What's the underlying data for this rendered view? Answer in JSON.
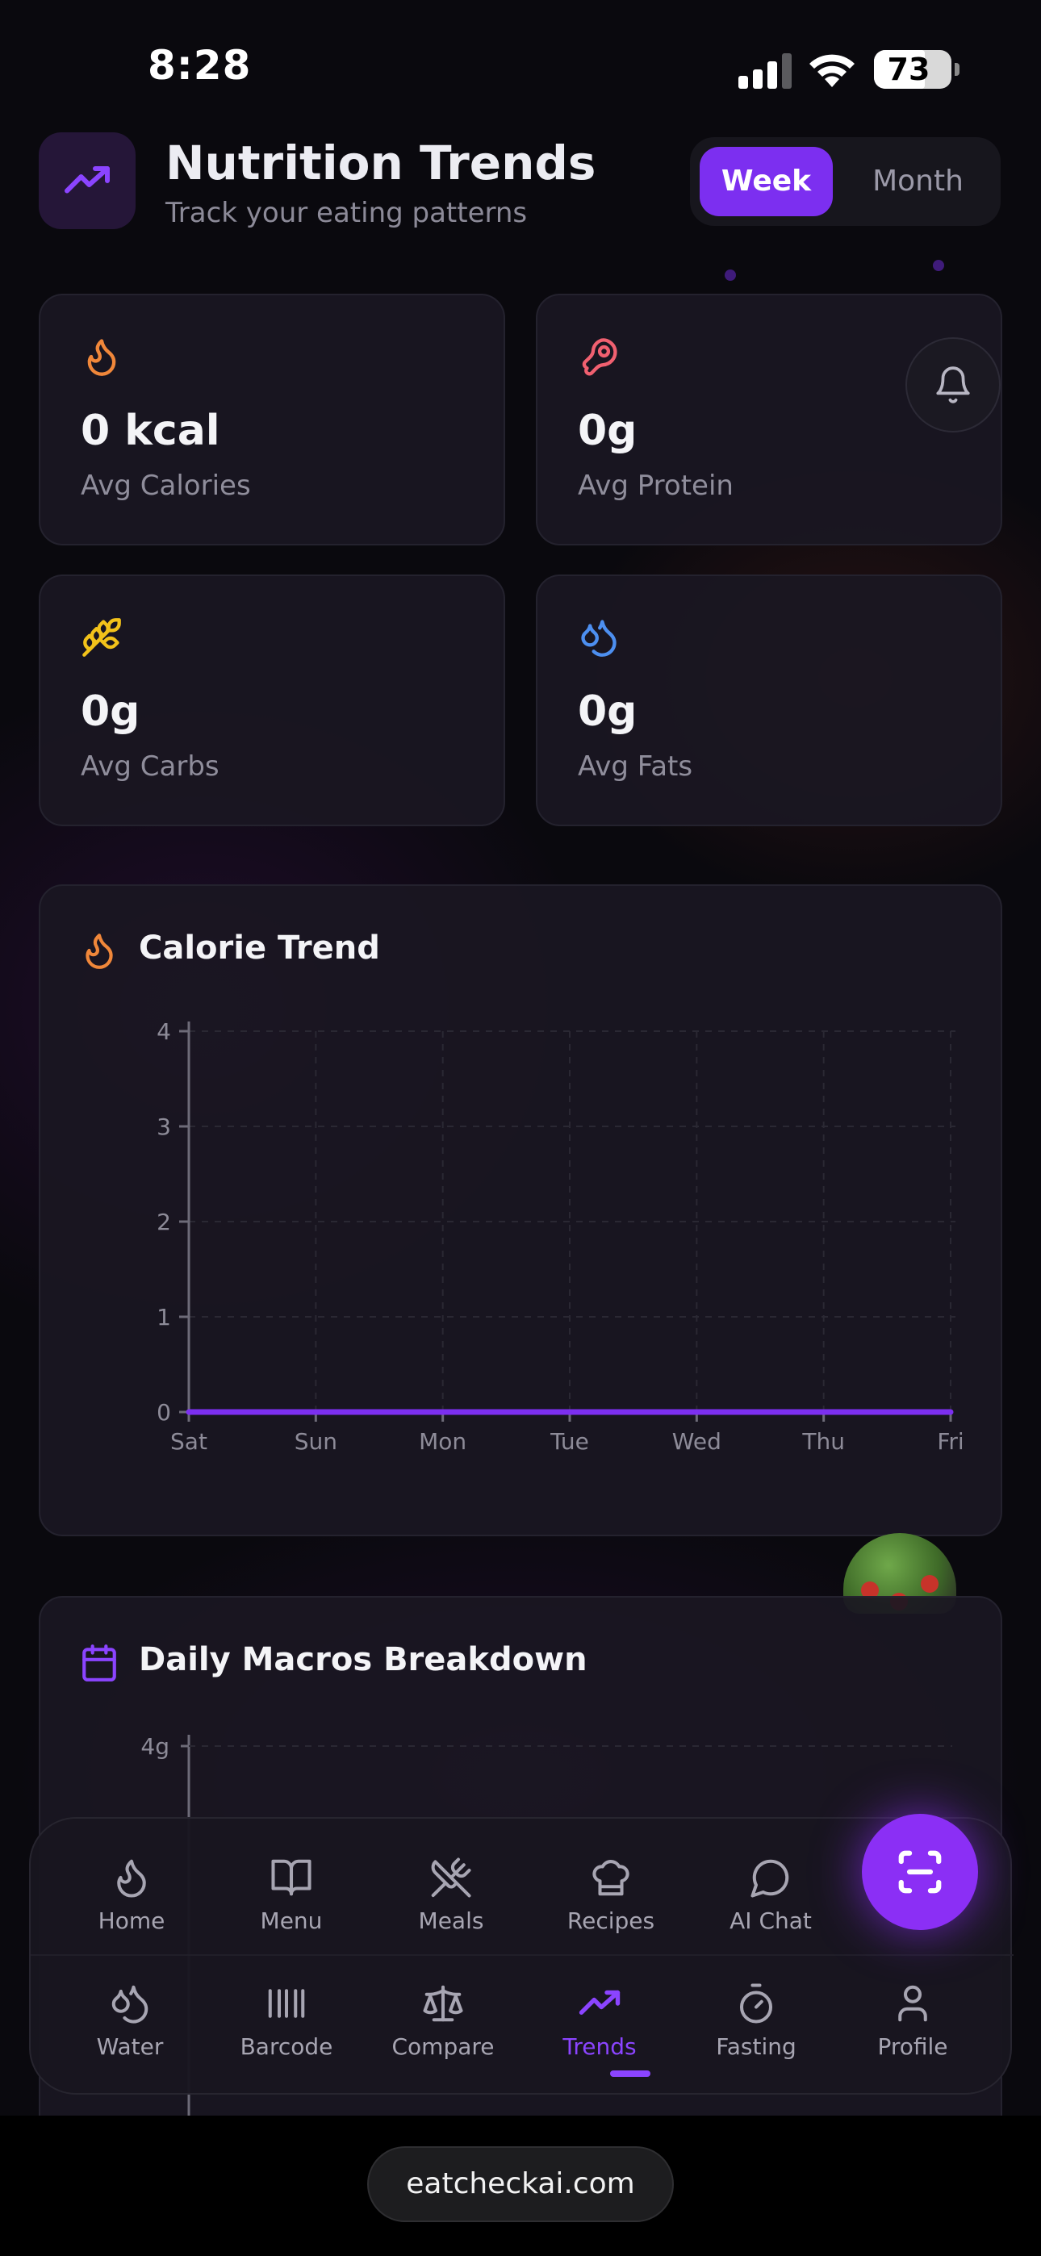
{
  "status_bar": {
    "time": "8:28",
    "battery_percent": "73",
    "battery_level": 0.73
  },
  "header": {
    "title": "Nutrition Trends",
    "subtitle": "Track your eating patterns",
    "icon": "trending-up-icon",
    "toggle": {
      "active": "Week",
      "inactive": "Month"
    }
  },
  "stats": [
    {
      "value": "0 kcal",
      "label": "Avg Calories",
      "icon": "flame-icon",
      "color": "#f0873a"
    },
    {
      "value": "0g",
      "label": "Avg Protein",
      "icon": "meat-icon",
      "color": "#f06070"
    },
    {
      "value": "0g",
      "label": "Avg Carbs",
      "icon": "wheat-icon",
      "color": "#f2c21a"
    },
    {
      "value": "0g",
      "label": "Avg Fats",
      "icon": "droplets-icon",
      "color": "#4d8ff0"
    }
  ],
  "calorie_trend": {
    "title": "Calorie Trend",
    "icon": "flame-icon"
  },
  "macros_breakdown": {
    "title": "Daily Macros Breakdown",
    "icon": "calendar-icon",
    "visible_tick": "4g"
  },
  "chart_data": {
    "type": "line",
    "title": "Calorie Trend",
    "categories": [
      "Sat",
      "Sun",
      "Mon",
      "Tue",
      "Wed",
      "Thu",
      "Fri"
    ],
    "series": [
      {
        "values": [
          0,
          0,
          0,
          0,
          0,
          0,
          0
        ],
        "color": "#7c2ff0"
      }
    ],
    "yticks": [
      "0",
      "1",
      "2",
      "3",
      "4"
    ],
    "ylim": [
      0,
      4
    ],
    "grid": true
  },
  "nav": {
    "row1": [
      {
        "label": "Home",
        "icon": "flame-icon"
      },
      {
        "label": "Menu",
        "icon": "book-icon"
      },
      {
        "label": "Meals",
        "icon": "utensils-crossed-icon"
      },
      {
        "label": "Recipes",
        "icon": "chef-hat-icon"
      },
      {
        "label": "AI Chat",
        "icon": "chat-bubble-icon"
      }
    ],
    "row2": [
      {
        "label": "Water",
        "icon": "droplets-icon"
      },
      {
        "label": "Barcode",
        "icon": "barcode-icon"
      },
      {
        "label": "Compare",
        "icon": "scale-icon"
      },
      {
        "label": "Trends",
        "icon": "trending-up-icon",
        "active": true
      },
      {
        "label": "Fasting",
        "icon": "timer-icon"
      },
      {
        "label": "Profile",
        "icon": "user-icon"
      }
    ],
    "active_color": "#8b44ff",
    "fab_icon": "scan-icon"
  },
  "browser": {
    "url": "eatcheckai.com"
  }
}
